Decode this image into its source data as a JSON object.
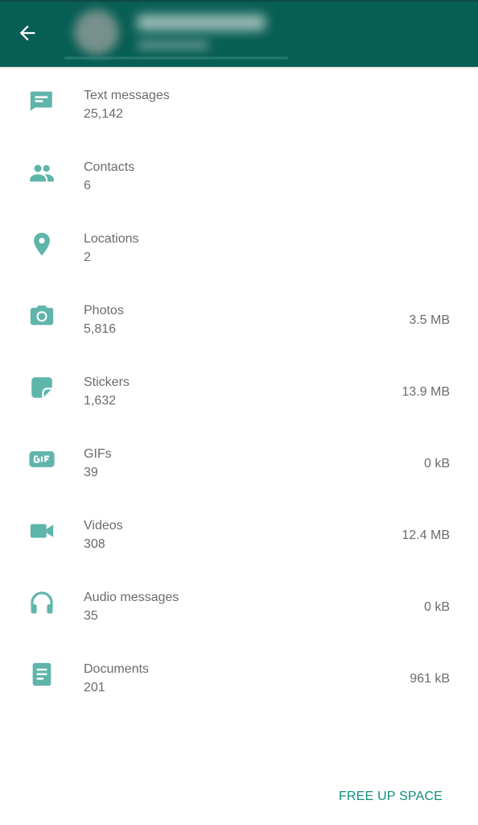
{
  "colors": {
    "app_bar": "#075e54",
    "icon": "#5fb5aa",
    "accent_text": "#128c7e",
    "secondary_text": "#6b6b6b"
  },
  "header": {
    "back_icon": "arrow-left-icon"
  },
  "items": [
    {
      "icon": "message-icon",
      "title": "Text messages",
      "count": "25,142",
      "size": ""
    },
    {
      "icon": "contacts-icon",
      "title": "Contacts",
      "count": "6",
      "size": ""
    },
    {
      "icon": "location-pin-icon",
      "title": "Locations",
      "count": "2",
      "size": ""
    },
    {
      "icon": "camera-icon",
      "title": "Photos",
      "count": "5,816",
      "size": "3.5 MB"
    },
    {
      "icon": "sticker-icon",
      "title": "Stickers",
      "count": "1,632",
      "size": "13.9 MB"
    },
    {
      "icon": "gif-icon",
      "title": "GIFs",
      "count": "39",
      "size": "0 kB"
    },
    {
      "icon": "video-icon",
      "title": "Videos",
      "count": "308",
      "size": "12.4 MB"
    },
    {
      "icon": "headphones-icon",
      "title": "Audio messages",
      "count": "35",
      "size": "0 kB"
    },
    {
      "icon": "document-icon",
      "title": "Documents",
      "count": "201",
      "size": "961 kB"
    }
  ],
  "footer": {
    "free_up_space_label": "FREE UP SPACE"
  }
}
